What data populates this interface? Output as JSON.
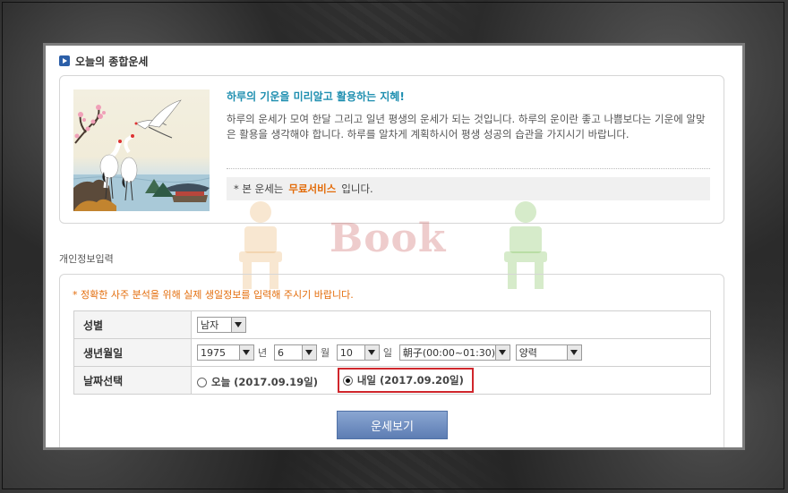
{
  "section": {
    "title": "오늘의 종합운세"
  },
  "intro": {
    "heading": "하루의 기운을 미리알고 활용하는 지혜!",
    "text": "하루의 운세가 모여 한달 그리고 일년 평생의 운세가 되는 것입니다. 하루의 운이란 좋고 나쁨보다는 기운에 알맞은 활용을 생각해야 합니다. 하루를 알차게 계획하시어 평생 성공의 습관을 가지시기 바랍니다.",
    "notice_prefix": "* 본 운세는",
    "notice_highlight": "무료서비스",
    "notice_suffix": "입니다."
  },
  "watermark": {
    "text": "Book"
  },
  "personal": {
    "title": "개인정보입력",
    "note": "* 정확한 사주 분석을 위해 실제 생일정보를 입력해 주시기 바랍니다."
  },
  "form": {
    "gender": {
      "label": "성별",
      "value": "남자"
    },
    "birth": {
      "label": "생년월일",
      "year": "1975",
      "year_unit": "년",
      "month": "6",
      "month_unit": "월",
      "day": "10",
      "day_unit": "일",
      "hour": "朝子(00:00~01:30)",
      "calendar": "양력"
    },
    "date": {
      "label": "날짜선택",
      "today": "오늘 (2017.09.19일)",
      "tomorrow": "내일 (2017.09.20일)",
      "selected": "tomorrow"
    },
    "submit_label": "운세보기"
  },
  "colors": {
    "accent": "#1f8fb0",
    "highlight": "#e36c0a",
    "selection_box": "#d0262c"
  },
  "icons": [
    "play-bullet-icon",
    "crane-illustration",
    "dropdown-arrow-icon",
    "radio-icon"
  ]
}
